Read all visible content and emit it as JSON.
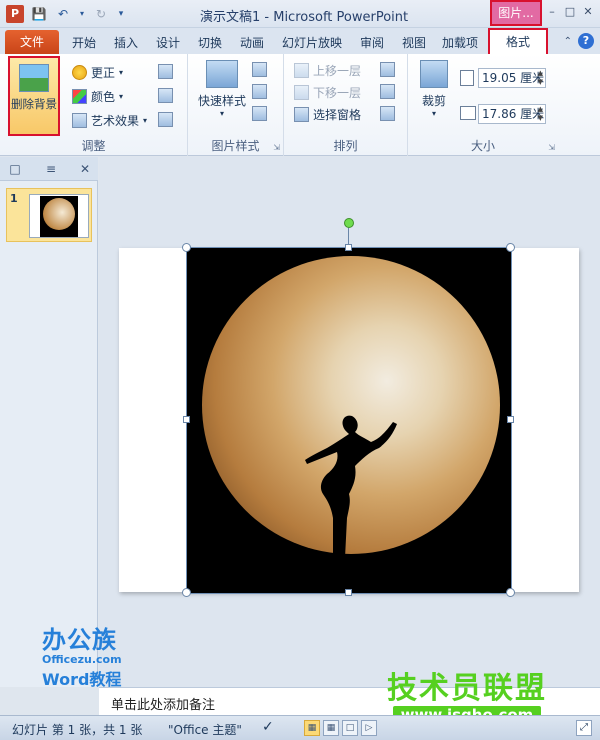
{
  "window": {
    "title": "演示文稿1 - Microsoft PowerPoint",
    "app_icon": "P",
    "context_tab_title": "图片...",
    "qat": {
      "save_icon": "save-icon",
      "undo_icon": "undo-icon",
      "redo_icon": "redo-icon"
    }
  },
  "tabs": {
    "file": "文件",
    "items": [
      "开始",
      "插入",
      "设计",
      "切换",
      "动画",
      "幻灯片放映",
      "审阅",
      "视图",
      "加载项"
    ],
    "format": "格式"
  },
  "ribbon": {
    "adjust": {
      "label": "调整",
      "remove_bg": "删除背景",
      "corrections": "更正",
      "color": "颜色",
      "artistic": "艺术效果"
    },
    "picture_styles": {
      "label": "图片样式",
      "quick_styles": "快速样式"
    },
    "arrange": {
      "label": "排列",
      "bring_forward": "上移一层",
      "send_backward": "下移一层",
      "selection_pane": "选择窗格"
    },
    "size": {
      "label": "大小",
      "crop": "裁剪",
      "height": "19.05 厘米",
      "width": "17.86 厘米"
    }
  },
  "slides_panel": {
    "slide_number": "1"
  },
  "notes": {
    "placeholder": "单击此处添加备注"
  },
  "watermark": {
    "left_logo": "办公族",
    "left_site": "Officezu.com",
    "left_word": "Word教程",
    "right_logo": "技术员联盟",
    "right_url": "www.jsgho.com"
  },
  "status": {
    "slide_info": "幻灯片 第 1 张，共 1 张",
    "theme": "\"Office 主题\""
  }
}
